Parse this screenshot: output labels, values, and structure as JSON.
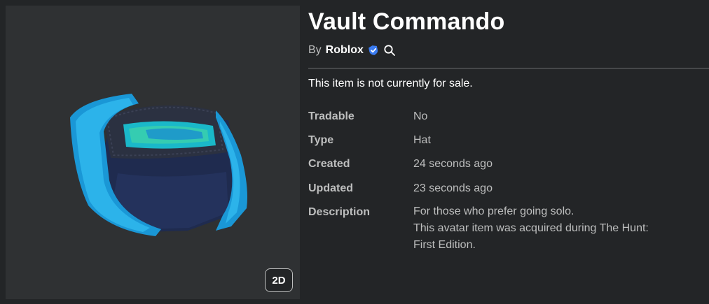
{
  "item": {
    "title": "Vault Commando",
    "by_label": "By",
    "creator": "Roblox",
    "sale_status": "This item is not currently for sale."
  },
  "thumbnail": {
    "toggle_label": "2D"
  },
  "details": [
    {
      "label": "Tradable",
      "value": "No"
    },
    {
      "label": "Type",
      "value": "Hat"
    },
    {
      "label": "Created",
      "value": "24 seconds ago"
    },
    {
      "label": "Updated",
      "value": "23 seconds ago"
    }
  ],
  "description": {
    "label": "Description",
    "lines": [
      "For those who prefer going solo.",
      "This avatar item was acquired during The Hunt:",
      "First Edition."
    ]
  },
  "icons": {
    "verified": "verified-badge-icon",
    "search": "search-icon"
  },
  "colors": {
    "background": "#232527",
    "panel": "#2f3133",
    "text_primary": "#ffffff",
    "text_secondary": "#bdbebe",
    "verified_blue": "#3a7bf1"
  }
}
